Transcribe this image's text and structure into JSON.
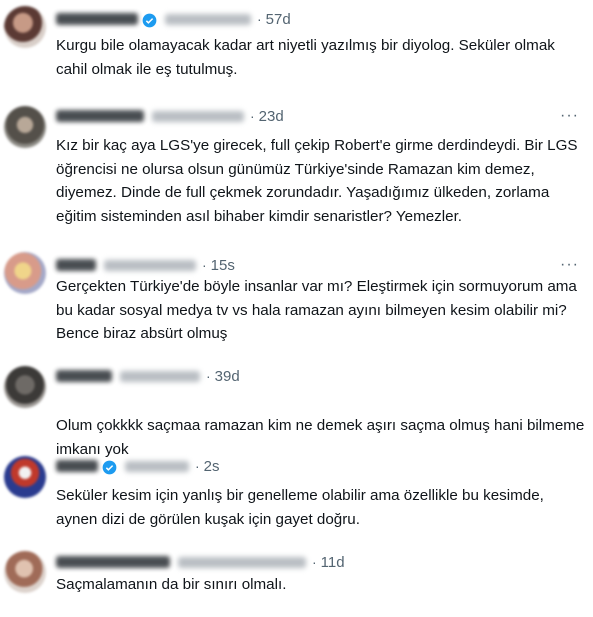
{
  "replies": [
    {
      "time": "57d",
      "text": "Kurgu bile olamayacak kadar art niyetli yazılmış bir diyolog. Seküler olmak cahil olmak ile eş tutulmuş.",
      "verified": true,
      "more_menu": false
    },
    {
      "time": "23d",
      "text": "Kız bir kaç aya LGS'ye girecek, full çekip Robert'e girme derdindeydi. Bir LGS öğrencisi ne olursa olsun günümüz Türkiye'sinde Ramazan kim demez, diyemez. Dinde de full çekmek zorundadır. Yaşadığımız ülkeden, zorlama eğitim sisteminden asıl bihaber kimdir senaristler? Yemezler.",
      "verified": false,
      "more_menu": true
    },
    {
      "time": "15s",
      "text": "Gerçekten Türkiye'de böyle insanlar var mı? Eleştirmek için sormuyorum ama bu kadar sosyal medya tv vs hala ramazan ayını bilmeyen kesim olabilir mi? Bence biraz absürt olmuş",
      "verified": false,
      "more_menu": true
    },
    {
      "time": "39d",
      "text": "Olum çokkkk saçmaa ramazan kim ne demek aşırı saçma olmuş hani bilmeme imkanı yok",
      "verified": false,
      "more_menu": false
    },
    {
      "time": "2s",
      "text": "Seküler kesim için yanlış bir genelleme olabilir ama özellikle bu kesimde, aynen dizi de görülen kuşak için gayet doğru.",
      "verified": true,
      "more_menu": false
    },
    {
      "time": "11d",
      "text": "Saçmalamanın da bir sınırı olmalı.",
      "verified": false,
      "more_menu": false
    }
  ],
  "icons": {
    "more": "more-options-icon",
    "verified": "verified-badge-icon"
  },
  "colors": {
    "text": "#0f1419",
    "secondary": "#536471",
    "verified": "#1d9bf0"
  }
}
